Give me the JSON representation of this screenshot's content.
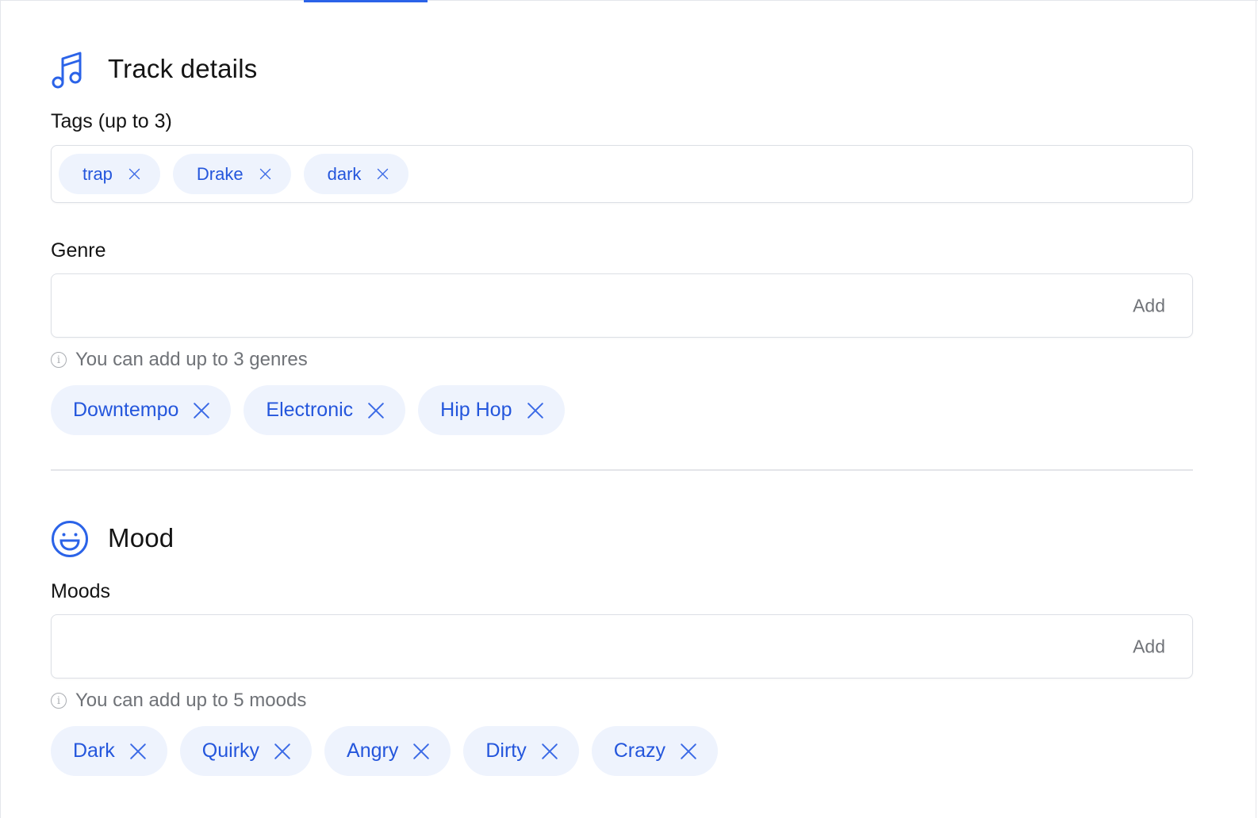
{
  "track_details": {
    "title": "Track details",
    "icon": "music-note-icon",
    "tags": {
      "label": "Tags (up to 3)",
      "items": [
        "trap",
        "Drake",
        "dark"
      ]
    },
    "genre": {
      "label": "Genre",
      "add_label": "Add",
      "hint": "You can add up to 3 genres",
      "items": [
        "Downtempo",
        "Electronic",
        "Hip Hop"
      ]
    }
  },
  "mood": {
    "title": "Mood",
    "icon": "smiley-face-icon",
    "moods": {
      "label": "Moods",
      "add_label": "Add",
      "hint": "You can add up to 5 moods",
      "items": [
        "Dark",
        "Quirky",
        "Angry",
        "Dirty",
        "Crazy"
      ]
    }
  },
  "colors": {
    "accent": "#2b63e8",
    "chip_bg": "#eef3fd",
    "chip_text": "#2456dc"
  }
}
